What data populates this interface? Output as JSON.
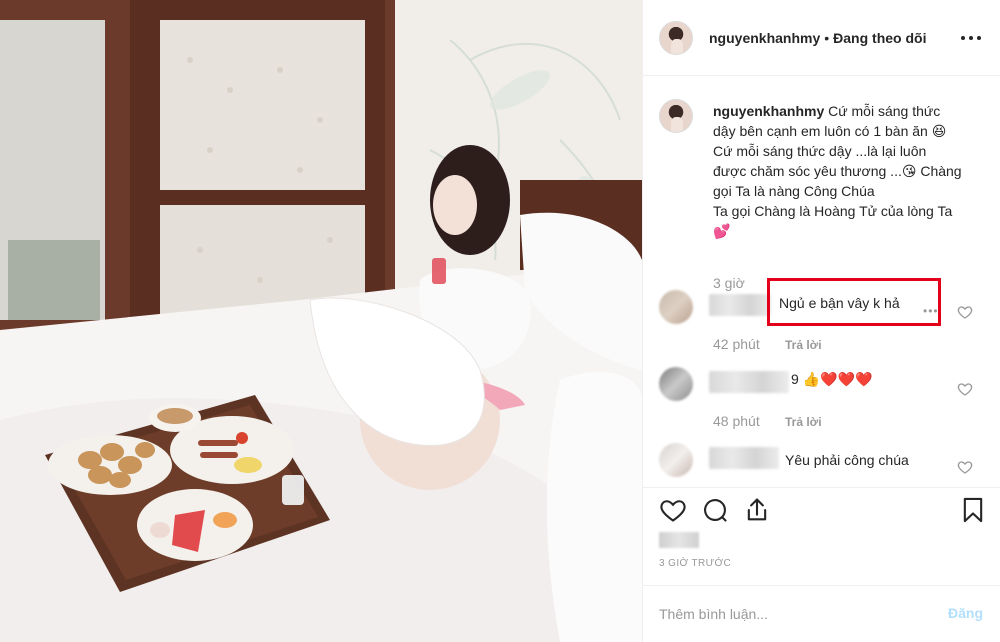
{
  "post": {
    "username": "nguyenkhanhmy",
    "separator": "•",
    "follow_status": "Đang theo dõi",
    "caption": {
      "username": "nguyenkhanhmy",
      "line1": "Cứ mỗi sáng thức",
      "line2": "dậy bên cạnh em luôn có 1 bàn ăn 😆",
      "line3": "Cứ mỗi sáng thức dậy ...là lại luôn",
      "line4": "được chăm sóc yêu thương ...😘 Chàng",
      "line5": "gọi Ta là nàng Công Chúa",
      "line6": "Ta gọi Chàng là Hoàng Tử của lòng Ta",
      "line7": "💕",
      "time": "3 giờ"
    },
    "comments": [
      {
        "text": "Ngủ e bận vây k hả",
        "time": "42 phút",
        "reply": "Trả lời"
      },
      {
        "text": "9 👍❤️❤️❤️",
        "time": "48 phút",
        "reply": "Trả lời"
      },
      {
        "text": "Yêu phải công chúa"
      }
    ],
    "posted_time": "3 GIỜ TRƯỚC",
    "add_comment_placeholder": "Thêm bình luận...",
    "post_button": "Đăng",
    "colors": {
      "highlight": "#e3001b",
      "muted": "#999999",
      "post_disabled": "#b2dffc"
    },
    "icons": [
      "more-icon",
      "heart-icon",
      "comment-icon",
      "share-icon",
      "bookmark-icon"
    ]
  }
}
